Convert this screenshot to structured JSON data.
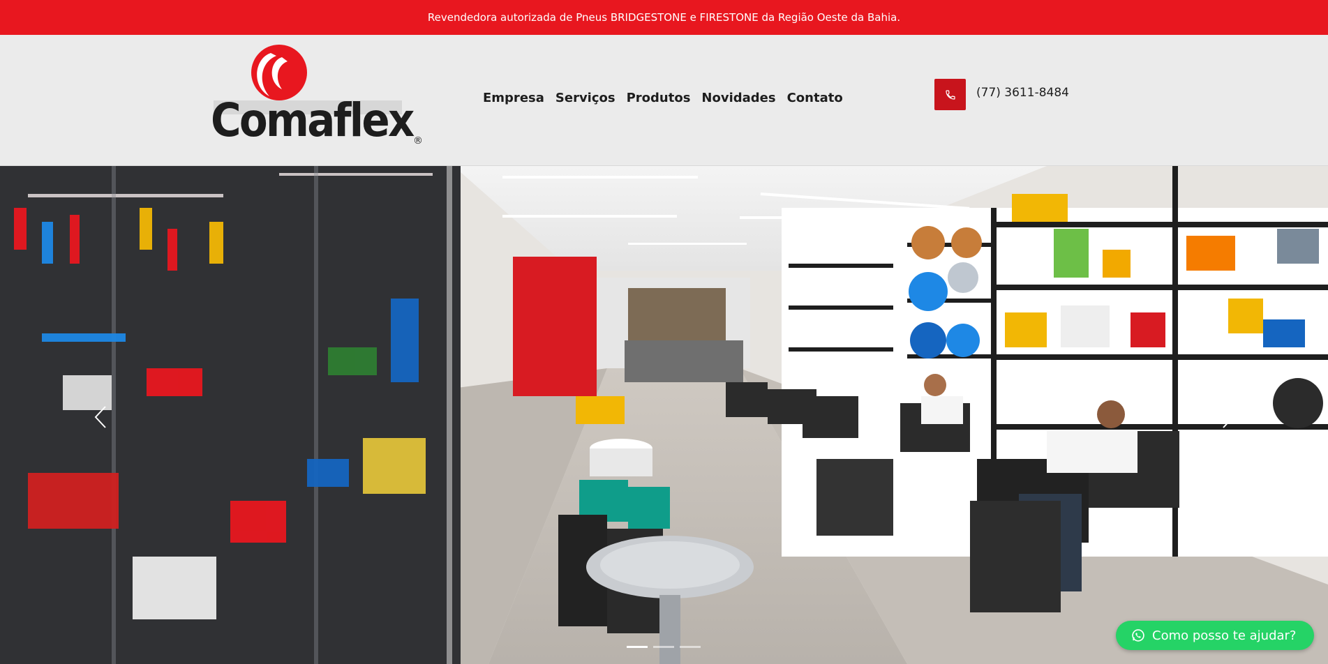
{
  "topbar": {
    "text": "Revendedora autorizada de Pneus BRIDGESTONE e FIRESTONE da Região Oeste da Bahia."
  },
  "logo": {
    "text": "Comaflex",
    "registered": "®"
  },
  "nav": {
    "items": [
      {
        "label": "Empresa"
      },
      {
        "label": "Serviços"
      },
      {
        "label": "Produtos"
      },
      {
        "label": "Novidades"
      },
      {
        "label": "Contato"
      }
    ]
  },
  "contact": {
    "phone": "(77) 3611-8484",
    "icon": "phone-icon"
  },
  "slider": {
    "prev_icon": "chevron-left-icon",
    "next_icon": "chevron-right-icon",
    "slide_count": 3,
    "active_slide": 1
  },
  "whatsapp": {
    "label": "Como posso te ajudar?",
    "icon": "whatsapp-icon"
  },
  "colors": {
    "brand_red": "#e8171f",
    "header_bg": "#ebebeb",
    "whatsapp_green": "#25d366"
  }
}
